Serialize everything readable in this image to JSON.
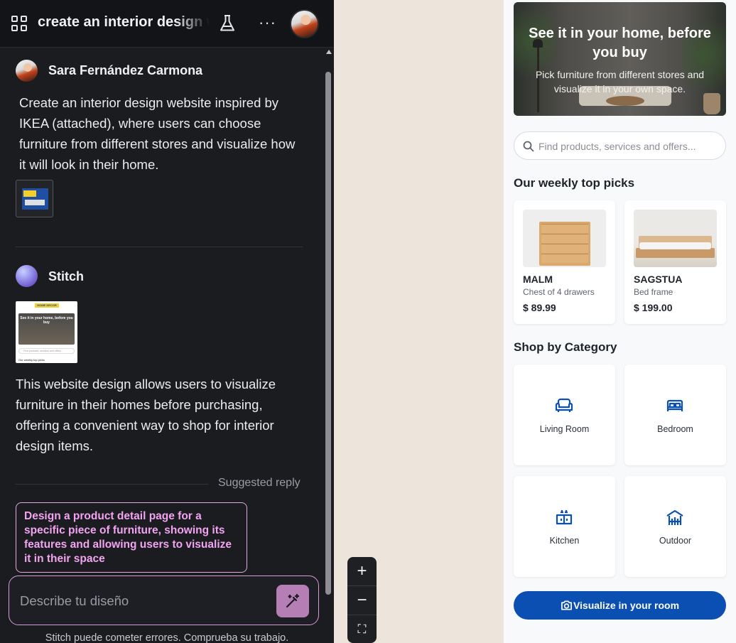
{
  "chat": {
    "title": "create an interior design website",
    "messages": {
      "user": {
        "name": "Sara Fernández Carmona",
        "text": "Create an interior design website inspired by IKEA (attached), where users can choose furniture from different stores and visualize how it will look in their home."
      },
      "bot": {
        "name": "Stitch",
        "text": "This website design allows users to visualize furniture in their homes before purchasing, offering a convenient way to shop for interior design items."
      }
    },
    "suggested_label": "Suggested reply",
    "suggested_reply": "Design a product detail page for a specific piece of furniture, showing its features and allowing users to visualize it in their space",
    "composer_placeholder": "Describe tu diseño",
    "disclaimer": "Stitch puede cometer errores. Comprueba su trabajo.",
    "thumbnail": {
      "logo": "HOME DECOR",
      "hero": "See it in your home, before you buy",
      "search": "Find products, services and offers...",
      "caption": "Our weekly top picks"
    }
  },
  "zoom": {
    "in": "+",
    "out": "−",
    "fit": "⛶"
  },
  "app": {
    "hero": {
      "title": "See it in your home, before you buy",
      "subtitle": "Pick furniture from different stores and visualize it in your own space."
    },
    "search_placeholder": "Find products, services and offers...",
    "top_picks_title": "Our weekly top picks",
    "top_picks": [
      {
        "name": "MALM",
        "desc": "Chest of 4 drawers",
        "price": "$ 89.99"
      },
      {
        "name": "SAGSTUA",
        "desc": "Bed frame",
        "price": "$ 199.00"
      }
    ],
    "category_title": "Shop by Category",
    "categories": [
      {
        "label": "Living Room",
        "icon": "sofa-icon"
      },
      {
        "label": "Bedroom",
        "icon": "bed-icon"
      },
      {
        "label": "Kitchen",
        "icon": "kitchen-icon"
      },
      {
        "label": "Outdoor",
        "icon": "outdoor-icon"
      }
    ],
    "cta_label": "Visualize in your room",
    "accent_color": "#0b4fb3"
  }
}
